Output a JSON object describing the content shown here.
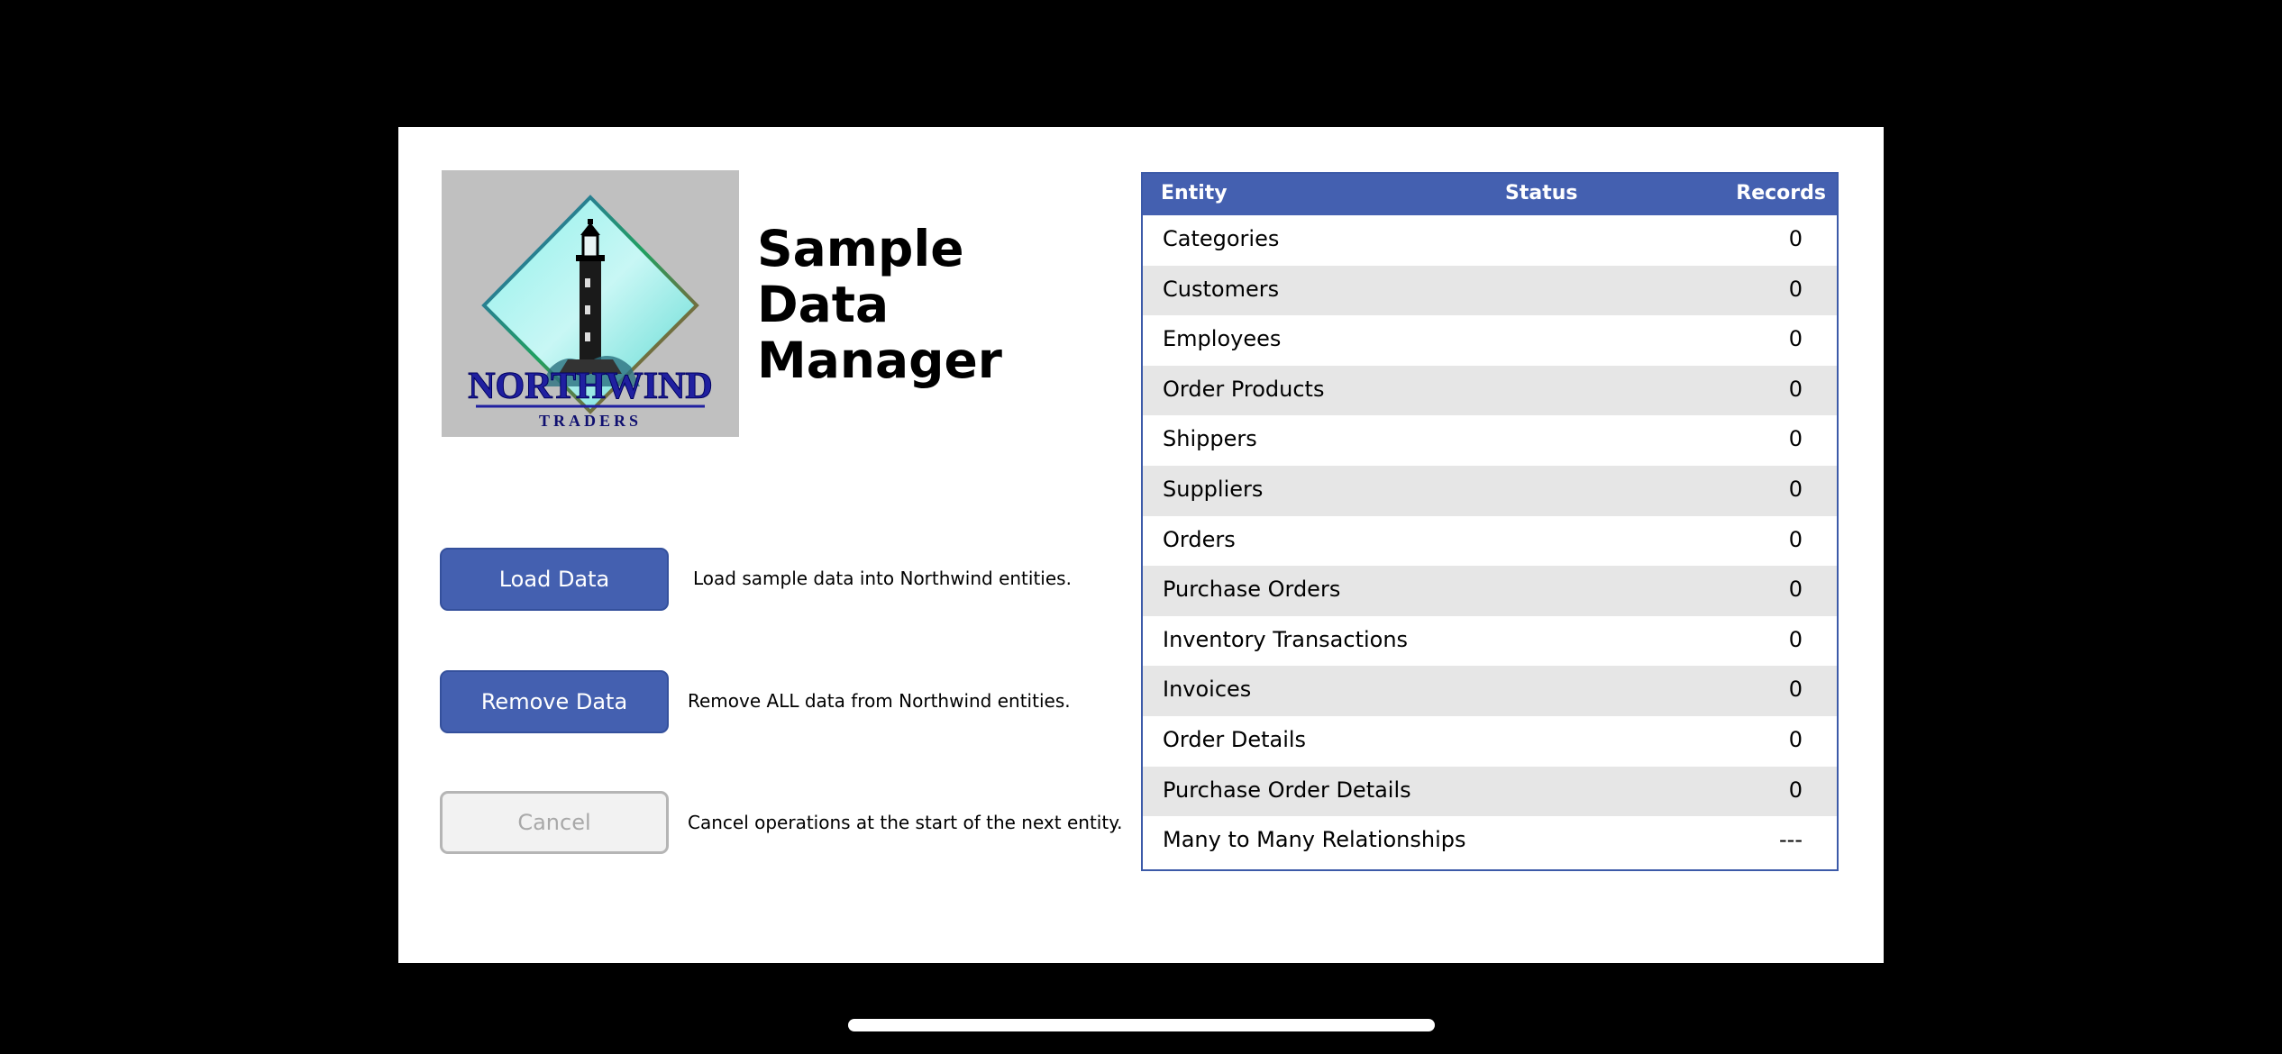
{
  "app": {
    "title": "Sample Data Manager",
    "logo": {
      "brand_name": "NORTHWIND",
      "brand_sub": "TRADERS"
    }
  },
  "actions": [
    {
      "label": "Load Data",
      "description": "Load sample data into Northwind entities.",
      "enabled": true
    },
    {
      "label": "Remove Data",
      "description": "Remove ALL data from Northwind entities.",
      "enabled": true
    },
    {
      "label": "Cancel",
      "description": "Cancel operations at the start of the next entity.",
      "enabled": false
    }
  ],
  "table": {
    "headers": {
      "entity": "Entity",
      "status": "Status",
      "records": "Records"
    },
    "rows": [
      {
        "entity": "Categories",
        "status": "",
        "records": "0"
      },
      {
        "entity": "Customers",
        "status": "",
        "records": "0"
      },
      {
        "entity": "Employees",
        "status": "",
        "records": "0"
      },
      {
        "entity": "Order Products",
        "status": "",
        "records": "0"
      },
      {
        "entity": "Shippers",
        "status": "",
        "records": "0"
      },
      {
        "entity": "Suppliers",
        "status": "",
        "records": "0"
      },
      {
        "entity": "Orders",
        "status": "",
        "records": "0"
      },
      {
        "entity": "Purchase Orders",
        "status": "",
        "records": "0"
      },
      {
        "entity": "Inventory Transactions",
        "status": "",
        "records": "0"
      },
      {
        "entity": "Invoices",
        "status": "",
        "records": "0"
      },
      {
        "entity": "Order Details",
        "status": "",
        "records": "0"
      },
      {
        "entity": "Purchase Order Details",
        "status": "",
        "records": "0"
      },
      {
        "entity": "Many to Many Relationships",
        "status": "",
        "records": "---"
      }
    ]
  },
  "colors": {
    "primary": "#4460b0",
    "table_border": "#3c5aa8",
    "row_alt": "#e6e6e6",
    "disabled_bg": "#f2f2f2",
    "disabled_text": "#a8a8a8"
  },
  "icons": {
    "logo": "lighthouse-icon",
    "home_indicator": "home-indicator-bar"
  }
}
